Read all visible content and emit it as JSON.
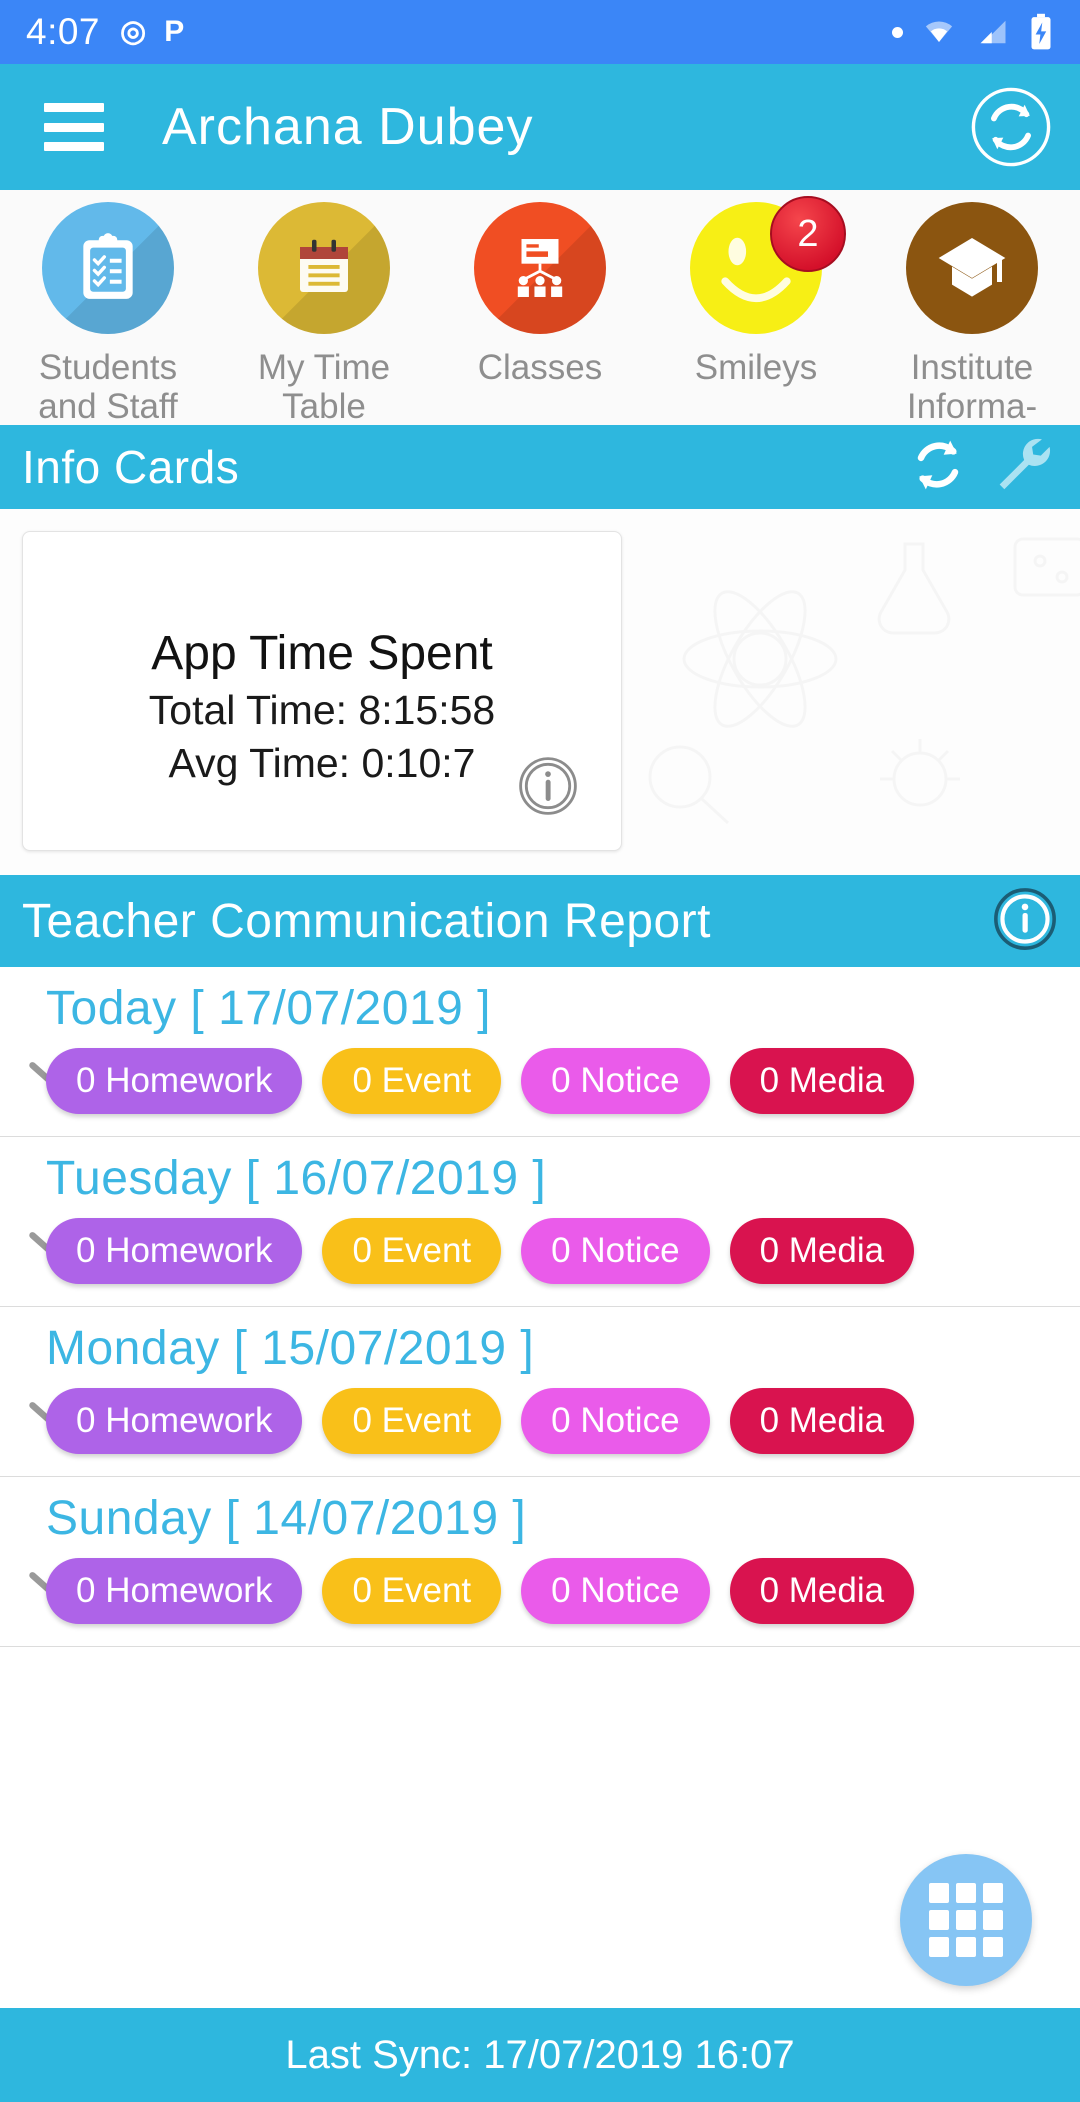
{
  "statusbar": {
    "time": "4:07",
    "icons": [
      "opera-icon",
      "p-app-icon",
      "dot-icon",
      "wifi-icon",
      "signal-icon",
      "battery-charging-icon"
    ],
    "bg_color": "#3b86f7"
  },
  "appbar": {
    "menu_icon": "hamburger-menu-icon",
    "title": "Archana  Dubey",
    "refresh_icon": "sync-refresh-icon",
    "bg_color": "#2eb7de"
  },
  "quick_actions": [
    {
      "label": "Students\nand Staff",
      "label_line1": "Students",
      "label_line2": "and Staff",
      "icon": "clipboard-checklist-icon",
      "color": "#62b9ea",
      "badge": null
    },
    {
      "label": "My Time\nTable",
      "label_line1": "My Time",
      "label_line2": "Table",
      "icon": "calendar-icon",
      "color": "#dcb935",
      "badge": null
    },
    {
      "label": "Classes",
      "label_line1": "Classes",
      "label_line2": "",
      "icon": "presentation-board-icon",
      "color": "#f04e23",
      "badge": null
    },
    {
      "label": "Smileys",
      "label_line1": "Smileys",
      "label_line2": "",
      "icon": "smiley-face-icon",
      "color": "#f7ef15",
      "badge": "2"
    },
    {
      "label": "Institute\nInforma-",
      "label_line1": "Institute",
      "label_line2": "Informa-",
      "icon": "graduation-cap-icon",
      "color": "#8b5510",
      "badge": null
    }
  ],
  "info_cards_section": {
    "title": "Info Cards",
    "refresh_icon": "refresh-icon",
    "settings_icon": "wrench-icon"
  },
  "app_time_card": {
    "title": "App Time Spent",
    "total_time_label": "Total Time: 8:15:58",
    "avg_time_label": "Avg Time: 0:10:7",
    "info_icon": "info-circle-icon"
  },
  "report_section": {
    "title": "Teacher Communication Report",
    "info_icon": "info-circle-icon"
  },
  "report_rows": [
    {
      "date": "Today [ 17/07/2019 ]",
      "expand_icon": "chevron-down-icon",
      "badges": [
        {
          "label": "0 Homework",
          "color": "#ae63e8"
        },
        {
          "label": "0 Event",
          "color": "#f9c019"
        },
        {
          "label": "0 Notice",
          "color": "#ea5bea"
        },
        {
          "label": "0 Media",
          "color": "#d9134f"
        }
      ]
    },
    {
      "date": "Tuesday [ 16/07/2019 ]",
      "expand_icon": "chevron-down-icon",
      "badges": [
        {
          "label": "0 Homework",
          "color": "#ae63e8"
        },
        {
          "label": "0 Event",
          "color": "#f9c019"
        },
        {
          "label": "0 Notice",
          "color": "#ea5bea"
        },
        {
          "label": "0 Media",
          "color": "#d9134f"
        }
      ]
    },
    {
      "date": "Monday [ 15/07/2019 ]",
      "expand_icon": "chevron-down-icon",
      "badges": [
        {
          "label": "0 Homework",
          "color": "#ae63e8"
        },
        {
          "label": "0 Event",
          "color": "#f9c019"
        },
        {
          "label": "0 Notice",
          "color": "#ea5bea"
        },
        {
          "label": "0 Media",
          "color": "#d9134f"
        }
      ]
    },
    {
      "date": "Sunday [ 14/07/2019 ]",
      "expand_icon": "chevron-down-icon",
      "badges": [
        {
          "label": "0 Homework",
          "color": "#ae63e8"
        },
        {
          "label": "0 Event",
          "color": "#f9c019"
        },
        {
          "label": "0 Notice",
          "color": "#ea5bea"
        },
        {
          "label": "0 Media",
          "color": "#d9134f"
        }
      ]
    }
  ],
  "fab": {
    "icon": "grid-apps-icon",
    "color": "#86c5f4"
  },
  "syncbar": {
    "text": "Last Sync: 17/07/2019 16:07",
    "bg_color": "#2eb7de"
  }
}
